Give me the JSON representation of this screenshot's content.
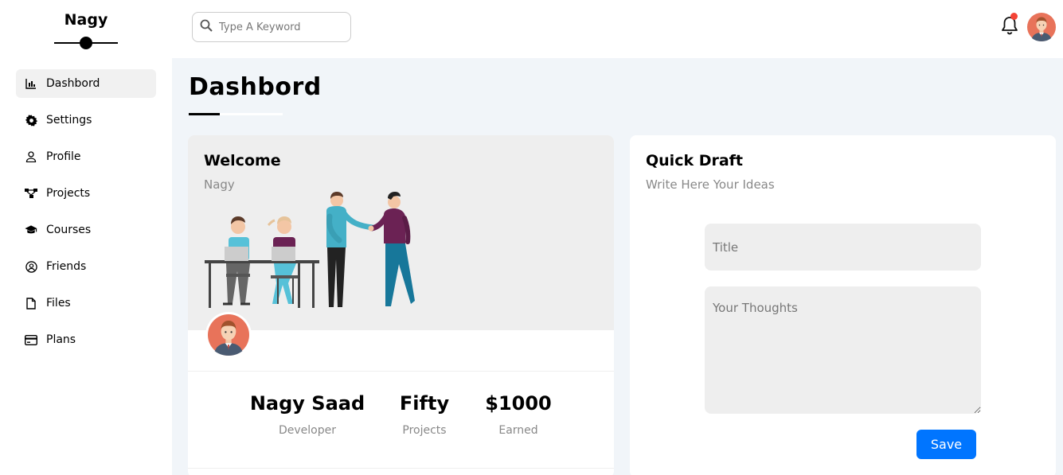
{
  "brand": {
    "name": "Nagy"
  },
  "sidebar": {
    "items": [
      {
        "label": "Dashbord",
        "icon": "chart-icon",
        "active": true
      },
      {
        "label": "Settings",
        "icon": "gear-icon"
      },
      {
        "label": "Profile",
        "icon": "user-icon"
      },
      {
        "label": "Projects",
        "icon": "diagram-icon"
      },
      {
        "label": "Courses",
        "icon": "graduation-cap-icon"
      },
      {
        "label": "Friends",
        "icon": "user-circle-icon"
      },
      {
        "label": "Files",
        "icon": "file-icon"
      },
      {
        "label": "Plans",
        "icon": "credit-card-icon"
      }
    ]
  },
  "header": {
    "search_placeholder": "Type A Keyword",
    "notification_badge_color": "#f44336"
  },
  "page": {
    "title": "Dashbord"
  },
  "welcome": {
    "title": "Welcome",
    "subtitle": "Nagy",
    "stats": [
      {
        "value": "Nagy Saad",
        "label": "Developer"
      },
      {
        "value": "Fifty",
        "label": "Projects"
      },
      {
        "value": "$1000",
        "label": "Earned"
      }
    ]
  },
  "draft": {
    "title": "Quick Draft",
    "subtitle": "Write Here Your Ideas",
    "title_placeholder": "Title",
    "thoughts_placeholder": "Your Thoughts",
    "save_label": "Save",
    "accent": "#0075ff"
  }
}
